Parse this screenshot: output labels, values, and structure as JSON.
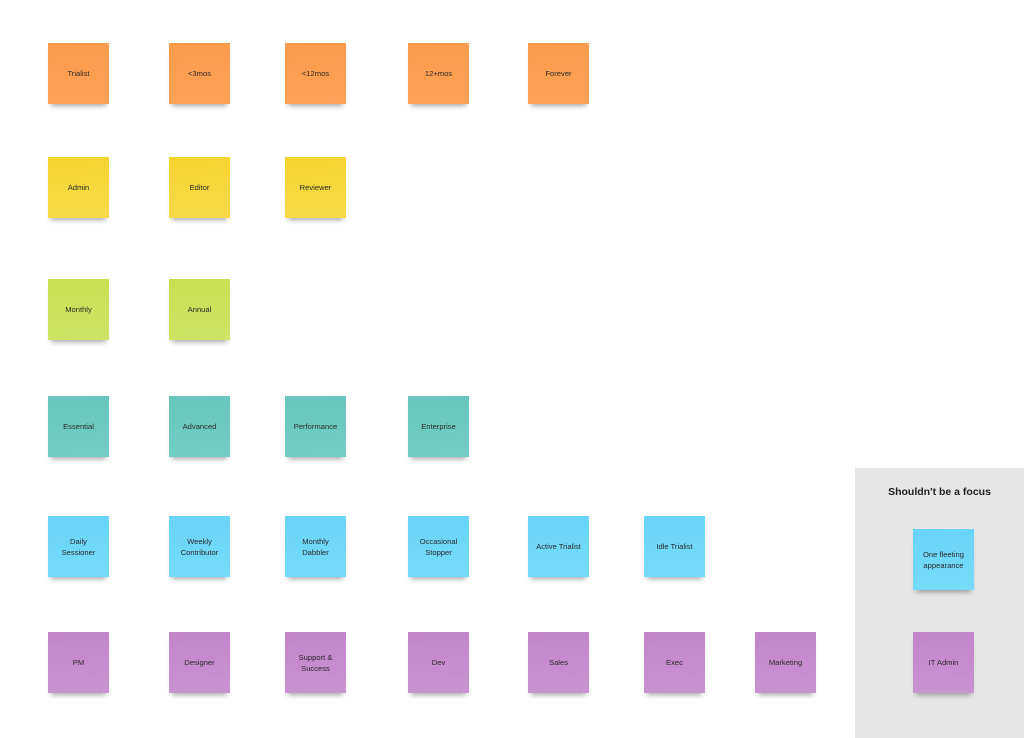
{
  "board": {
    "colors": {
      "orange": "#fd9d50",
      "yellow": "#f6d63a",
      "lime": "#cbe15b",
      "teal": "#6cc9c1",
      "blue": "#6ed7f8",
      "purple": "#c58bcd",
      "frame": "#e6e6e6"
    },
    "rows": {
      "tenure": [
        "Trialist",
        "<3mos",
        "<12mos",
        "12+mos",
        "Forever"
      ],
      "role": [
        "Admin",
        "Editor",
        "Reviewer"
      ],
      "billing": [
        "Monthly",
        "Annual"
      ],
      "plan": [
        "Essential",
        "Advanced",
        "Performance",
        "Enterprise"
      ],
      "engagement": [
        "Daily\nSessioner",
        "Weekly\nContributor",
        "Monthly\nDabbler",
        "Occasional\nStopper",
        "Active Trialist",
        "Idle Trialist"
      ],
      "persona": [
        "PM",
        "Designer",
        "Support &\nSuccess",
        "Dev",
        "Sales",
        "Exec",
        "Marketing"
      ]
    },
    "frame": {
      "title": "Shouldn't be a focus",
      "stickies": [
        "One fleeting\nappearance",
        "IT Admin"
      ]
    }
  }
}
